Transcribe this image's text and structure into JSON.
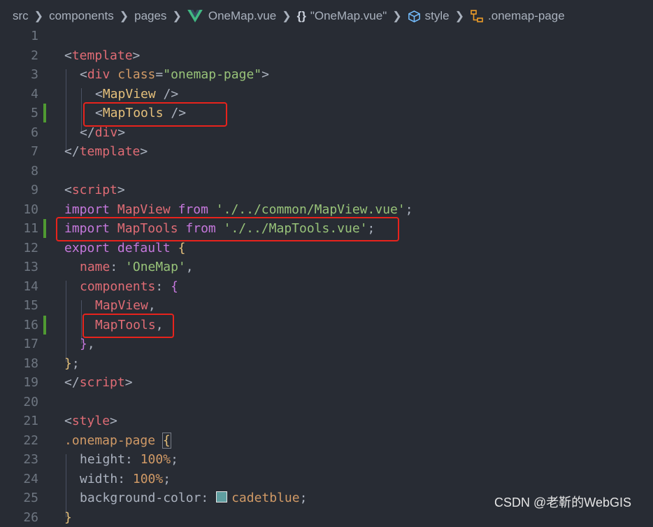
{
  "breadcrumb": {
    "items": [
      "src",
      "components",
      "pages",
      "OneMap.vue",
      "\"OneMap.vue\"",
      "style",
      ".onemap-page"
    ],
    "icons": [
      "vue-icon",
      "braces-icon",
      "cube-icon",
      "css-class-icon"
    ]
  },
  "colors": {
    "background": "#282c34",
    "highlight_box": "#e8231c",
    "git_modified": "#4f9a32",
    "swatch": "#5f9ea0"
  },
  "editor": {
    "lines": [
      {
        "n": "1"
      },
      {
        "n": "2"
      },
      {
        "n": "3"
      },
      {
        "n": "4"
      },
      {
        "n": "5"
      },
      {
        "n": "6"
      },
      {
        "n": "7"
      },
      {
        "n": "8"
      },
      {
        "n": "9"
      },
      {
        "n": "10"
      },
      {
        "n": "11"
      },
      {
        "n": "12"
      },
      {
        "n": "13"
      },
      {
        "n": "14"
      },
      {
        "n": "15"
      },
      {
        "n": "16"
      },
      {
        "n": "17"
      },
      {
        "n": "18"
      },
      {
        "n": "19"
      },
      {
        "n": "20"
      },
      {
        "n": "21"
      },
      {
        "n": "22"
      },
      {
        "n": "23"
      },
      {
        "n": "24"
      },
      {
        "n": "25"
      },
      {
        "n": "26"
      }
    ],
    "code": {
      "l2": {
        "open": "<",
        "tag": "template",
        "close": ">"
      },
      "l3": {
        "open": "<",
        "tag": "div",
        "attr": "class",
        "eq": "=",
        "val": "\"onemap-page\"",
        "close": ">"
      },
      "l4": {
        "open": "<",
        "comp": "MapView",
        "close": " />"
      },
      "l5": {
        "open": "<",
        "comp": "MapTools",
        "close": " />"
      },
      "l6": {
        "open": "</",
        "tag": "div",
        "close": ">"
      },
      "l7": {
        "open": "</",
        "tag": "template",
        "close": ">"
      },
      "l9": {
        "open": "<",
        "tag": "script",
        "close": ">"
      },
      "l10": {
        "kw1": "import",
        "id": "MapView",
        "kw2": "from",
        "str": "'./../common/MapView.vue'",
        "end": ";"
      },
      "l11": {
        "kw1": "import",
        "id": "MapTools",
        "kw2": "from",
        "str": "'./../MapTools.vue'",
        "end": ";"
      },
      "l12": {
        "kw1": "export",
        "kw2": "default",
        "brace": "{"
      },
      "l13": {
        "prop": "name",
        "colon": ":",
        "str": "'OneMap'",
        "end": ","
      },
      "l14": {
        "prop": "components",
        "colon": ":",
        "brace": "{"
      },
      "l15": {
        "id": "MapView",
        "end": ","
      },
      "l16": {
        "id": "MapTools",
        "end": ","
      },
      "l17": {
        "brace": "}",
        "end": ","
      },
      "l18": {
        "brace": "}",
        "end": ";"
      },
      "l19": {
        "open": "</",
        "tag": "script",
        "close": ">"
      },
      "l21": {
        "open": "<",
        "tag": "style",
        "close": ">"
      },
      "l22": {
        "sel": ".onemap-page",
        "brace": "{"
      },
      "l23": {
        "prop": "height",
        "colon": ":",
        "val": "100%",
        "end": ";"
      },
      "l24": {
        "prop": "width",
        "colon": ":",
        "val": "100%",
        "end": ";"
      },
      "l25": {
        "prop": "background-color",
        "colon": ":",
        "val": "cadetblue",
        "end": ";"
      },
      "l26": {
        "brace": "}"
      }
    },
    "modified_lines": [
      "5",
      "11",
      "16"
    ]
  },
  "watermark": "CSDN @老靳的WebGIS"
}
